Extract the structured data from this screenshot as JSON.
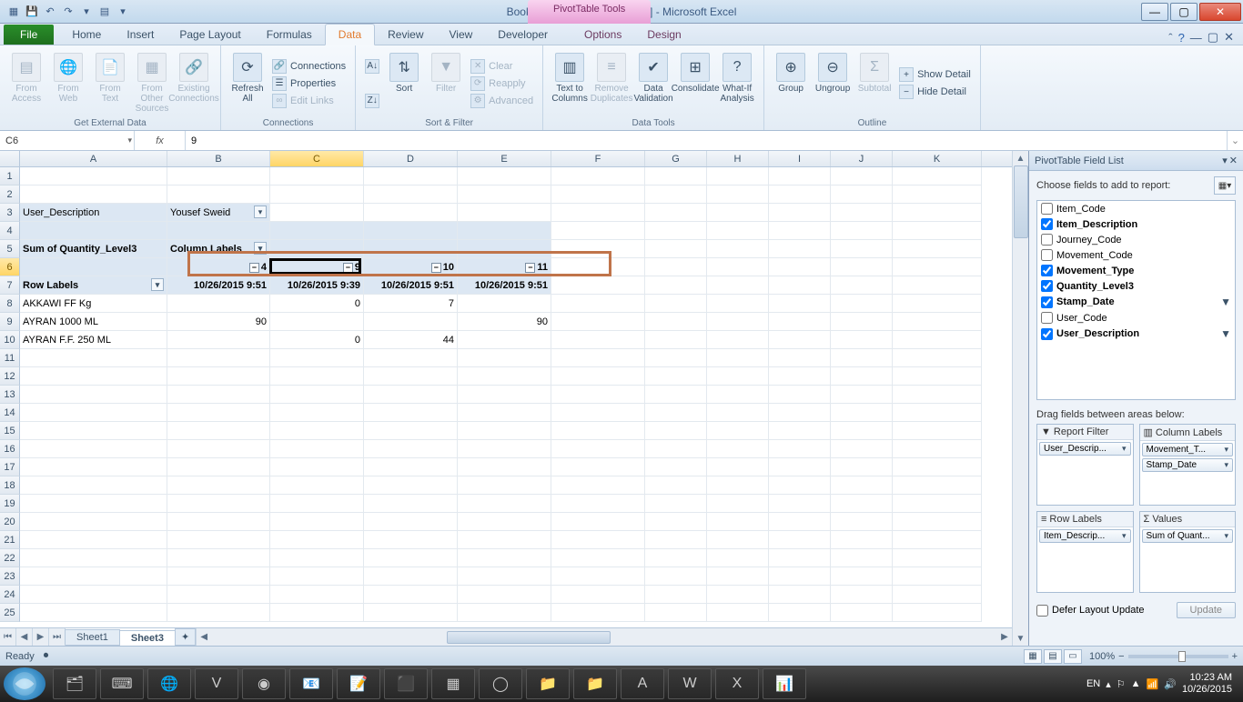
{
  "title": "Book1 (version 1) [Autosaved] - Microsoft Excel",
  "context_tab": "PivotTable Tools",
  "tabs": {
    "file": "File",
    "home": "Home",
    "insert": "Insert",
    "pagelayout": "Page Layout",
    "formulas": "Formulas",
    "data": "Data",
    "review": "Review",
    "view": "View",
    "developer": "Developer",
    "options": "Options",
    "design": "Design"
  },
  "ribbon": {
    "groups": {
      "ext_data": "Get External Data",
      "connections": "Connections",
      "sortfilter": "Sort & Filter",
      "datatools": "Data Tools",
      "outline": "Outline"
    },
    "btns": {
      "from_access": "From\nAccess",
      "from_web": "From\nWeb",
      "from_text": "From\nText",
      "from_other": "From Other\nSources",
      "existing": "Existing\nConnections",
      "refresh": "Refresh\nAll",
      "connections": "Connections",
      "properties": "Properties",
      "editlinks": "Edit Links",
      "sort": "Sort",
      "filter": "Filter",
      "clear": "Clear",
      "reapply": "Reapply",
      "advanced": "Advanced",
      "t2c": "Text to\nColumns",
      "remdup": "Remove\nDuplicates",
      "datavalid": "Data\nValidation",
      "consolidate": "Consolidate",
      "whatif": "What-If\nAnalysis",
      "group": "Group",
      "ungroup": "Ungroup",
      "subtotal": "Subtotal",
      "showdetail": "Show Detail",
      "hidedetail": "Hide Detail"
    }
  },
  "namebox": "C6",
  "formula": "9",
  "columns": [
    "A",
    "B",
    "C",
    "D",
    "E",
    "F",
    "G",
    "H",
    "I",
    "J",
    "K"
  ],
  "pivot": {
    "filter_name": "User_Description",
    "filter_value": "Yousef Sweid",
    "sum_label": "Sum of Quantity_Level3",
    "col_label": "Column Labels",
    "row_label": "Row Labels",
    "col_groups": [
      "4",
      "9",
      "10",
      "11"
    ],
    "col_dates": [
      "10/26/2015 9:51",
      "10/26/2015 9:39",
      "10/26/2015 9:51",
      "10/26/2015 9:51"
    ],
    "rows": [
      {
        "label": "AKKAWI FF Kg",
        "vals": [
          "",
          "0",
          "7",
          ""
        ]
      },
      {
        "label": "AYRAN 1000 ML",
        "vals": [
          "90",
          "",
          "",
          "90"
        ]
      },
      {
        "label": "AYRAN F.F. 250 ML",
        "vals": [
          "",
          "0",
          "44",
          ""
        ]
      }
    ]
  },
  "pane": {
    "title": "PivotTable Field List",
    "choose": "Choose fields to add to report:",
    "fields": [
      {
        "name": "Item_Code",
        "checked": false
      },
      {
        "name": "Item_Description",
        "checked": true
      },
      {
        "name": "Journey_Code",
        "checked": false
      },
      {
        "name": "Movement_Code",
        "checked": false
      },
      {
        "name": "Movement_Type",
        "checked": true
      },
      {
        "name": "Quantity_Level3",
        "checked": true
      },
      {
        "name": "Stamp_Date",
        "checked": true,
        "filter": true
      },
      {
        "name": "User_Code",
        "checked": false
      },
      {
        "name": "User_Description",
        "checked": true,
        "filter": true
      }
    ],
    "drag_label": "Drag fields between areas below:",
    "areas": {
      "report_filter": "Report Filter",
      "column_labels": "Column Labels",
      "row_labels": "Row Labels",
      "values": "Values",
      "rf_item": "User_Descrip...",
      "cl_item1": "Movement_T...",
      "cl_item2": "Stamp_Date",
      "rl_item": "Item_Descrip...",
      "v_item": "Sum of Quant..."
    },
    "defer": "Defer Layout Update",
    "update": "Update"
  },
  "sheets": {
    "s1": "Sheet1",
    "s3": "Sheet3"
  },
  "status": {
    "ready": "Ready",
    "zoom": "100%",
    "lang": "EN",
    "time": "10:23 AM",
    "date": "10/26/2015"
  }
}
